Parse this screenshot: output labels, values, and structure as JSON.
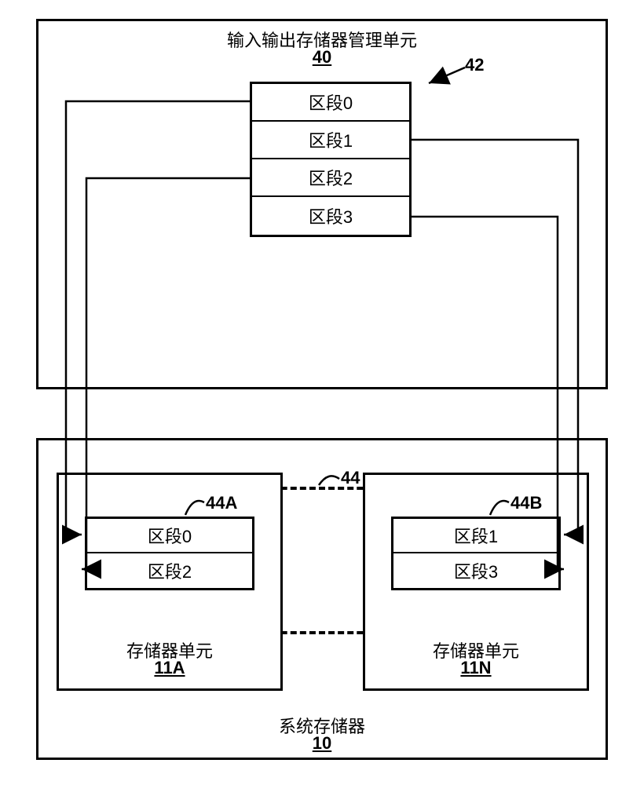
{
  "top_block": {
    "title": "输入输出存储器管理单元",
    "id": "40",
    "arrow_label": "42",
    "segments": [
      "区段0",
      "区段1",
      "区段2",
      "区段3"
    ]
  },
  "bottom_block": {
    "title": "系统存储器",
    "id": "10",
    "dashed_label": "44",
    "left_unit": {
      "label": "44A",
      "segments": [
        "区段0",
        "区段2"
      ],
      "footer": "存储器单元",
      "footer_id": "11A"
    },
    "right_unit": {
      "label": "44B",
      "segments": [
        "区段1",
        "区段3"
      ],
      "footer": "存储器单元",
      "footer_id": "11N"
    }
  },
  "chart_data": {
    "type": "diagram",
    "description": "Block diagram showing IOMMU (unit 40) containing a 4-entry segment table (42) mapped into system memory (10). System memory has a distributed page table (44) split across two memory units 11A (44A holding segments 0 and 2) and 11N (44B holding segments 1 and 3). Arrows connect each segment in block 42 to its copy in 44A or 44B.",
    "mappings": [
      {
        "from": "区段0",
        "to_unit": "11A"
      },
      {
        "from": "区段1",
        "to_unit": "11N"
      },
      {
        "from": "区段2",
        "to_unit": "11A"
      },
      {
        "from": "区段3",
        "to_unit": "11N"
      }
    ]
  }
}
